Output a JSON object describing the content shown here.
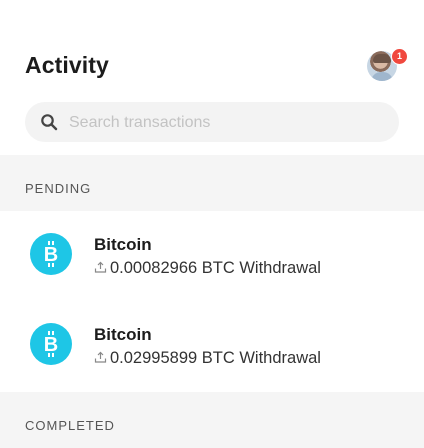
{
  "header": {
    "title": "Activity",
    "notification_count": "1"
  },
  "search": {
    "placeholder": "Search transactions",
    "value": ""
  },
  "sections": [
    {
      "label": "PENDING",
      "items": [
        {
          "title": "Bitcoin",
          "amount": "0.00082966 BTC Withdrawal",
          "icon": "bitcoin-icon",
          "direction_icon": "upload-icon"
        },
        {
          "title": "Bitcoin",
          "amount": "0.02995899 BTC Withdrawal",
          "icon": "bitcoin-icon",
          "direction_icon": "upload-icon"
        }
      ]
    },
    {
      "label": "COMPLETED"
    }
  ],
  "colors": {
    "bitcoin": "#1ec6e6",
    "badge": "#f0483e",
    "section_bg": "#f5f5f5"
  }
}
